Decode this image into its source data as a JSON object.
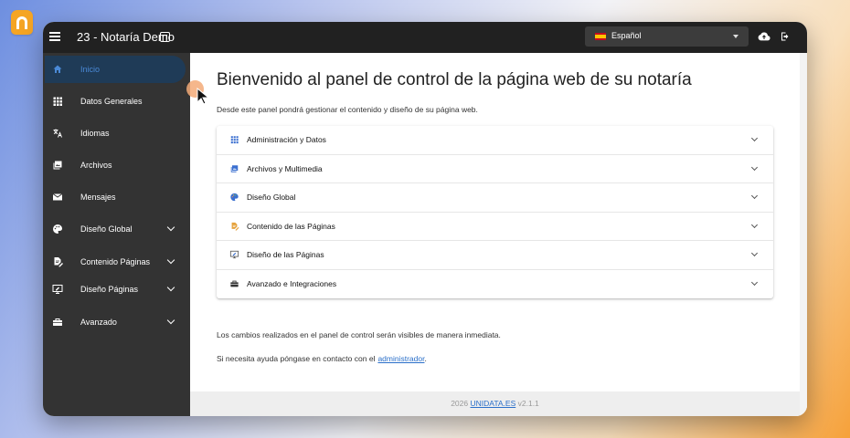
{
  "app": {
    "title": "23 - Notaría Demo",
    "language": "Español",
    "accent_color": "#1f3b57",
    "link_color": "#2a6fc9"
  },
  "sidebar": {
    "items": [
      {
        "label": "Inicio",
        "icon": "home-icon",
        "active": true
      },
      {
        "label": "Datos Generales",
        "icon": "grid-icon"
      },
      {
        "label": "Idiomas",
        "icon": "translate-icon"
      },
      {
        "label": "Archivos",
        "icon": "images-icon"
      },
      {
        "label": "Mensajes",
        "icon": "mail-icon"
      },
      {
        "label": "Diseño Global",
        "icon": "palette-icon",
        "expandable": true
      },
      {
        "label": "Contenido Páginas",
        "icon": "edit-document-icon",
        "expandable": true
      },
      {
        "label": "Diseño Páginas",
        "icon": "monitor-edit-icon",
        "expandable": true
      },
      {
        "label": "Avanzado",
        "icon": "toolbox-icon",
        "expandable": true
      }
    ]
  },
  "main": {
    "title": "Bienvenido al panel de control de la página web de su notaría",
    "description": "Desde este panel pondrá gestionar el contenido y diseño de su página web.",
    "sections": [
      {
        "label": "Administración y Datos",
        "icon": "grid-icon",
        "icon_color": "#3a6fd0"
      },
      {
        "label": "Archivos y Multimedia",
        "icon": "images-icon",
        "icon_color": "#3a6fd0"
      },
      {
        "label": "Diseño Global",
        "icon": "palette-icon",
        "icon_color": "#3a6fd0"
      },
      {
        "label": "Contenido de las Páginas",
        "icon": "edit-document-icon",
        "icon_color": "#e6a23c"
      },
      {
        "label": "Diseño de las Páginas",
        "icon": "monitor-edit-icon",
        "icon_color": "#555555"
      },
      {
        "label": "Avanzado e Integraciones",
        "icon": "toolbox-icon",
        "icon_color": "#333333"
      }
    ],
    "note_changes": "Los cambios realizados en el panel de control serán visibles de manera inmediata.",
    "note_help": "Si necesita ayuda póngase en contacto con el",
    "help_link": "administrador",
    "help_suffix": "."
  },
  "footer": {
    "year": "2026",
    "company": "UNIDATA.ES",
    "version": "v2.1.1"
  }
}
